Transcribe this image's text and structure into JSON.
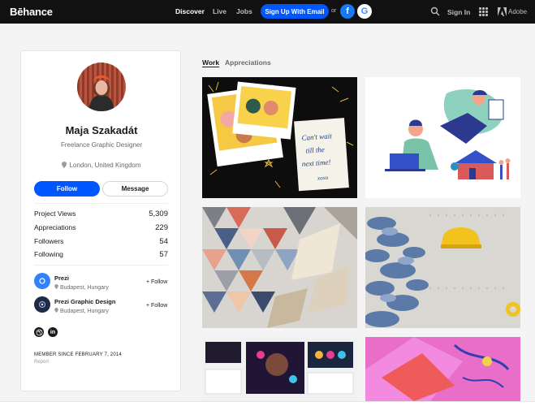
{
  "header": {
    "logo": "Bēhance",
    "nav": [
      "Discover",
      "Live",
      "Jobs"
    ],
    "signup_label": "Sign Up With Email",
    "or_label": "or",
    "facebook_label": "f",
    "google_label": "G",
    "signin_label": "Sign In",
    "adobe_label": "Adobe"
  },
  "profile": {
    "name": "Maja Szakadát",
    "role": "Freelance Graphic Designer",
    "location": "London, United Kingdom",
    "follow_label": "Follow",
    "message_label": "Message",
    "stats": [
      {
        "label": "Project Views",
        "value": "5,309"
      },
      {
        "label": "Appreciations",
        "value": "229"
      },
      {
        "label": "Followers",
        "value": "54"
      },
      {
        "label": "Following",
        "value": "57"
      }
    ],
    "teams": [
      {
        "name": "Prezi",
        "location": "Budapest, Hungary",
        "follow_label": "+ Follow",
        "color": "#3181ff"
      },
      {
        "name": "Prezi Graphic Design",
        "location": "Budapest, Hungary",
        "follow_label": "+ Follow",
        "color": "#1f2a44"
      }
    ],
    "social": [
      "dribbble-icon",
      "linkedin-icon"
    ],
    "linkedin_glyph": "in",
    "member_since": "MEMBER SINCE FEBRUARY 7, 2014",
    "report_label": "Report"
  },
  "tabs": [
    "Work",
    "Appreciations"
  ],
  "gallery": {
    "tile1_title": "Can't wait till the next time! xoxo",
    "tile1_sign": "xoxo",
    "tiles": [
      "friends-polaroid-illustration",
      "remote-work-illustration",
      "paper-triangles-wall",
      "blue-plants-pegboard",
      "presentation-screens",
      "pink-illustration"
    ]
  },
  "colors": {
    "accent": "#0057ff",
    "topbar": "#111111"
  }
}
